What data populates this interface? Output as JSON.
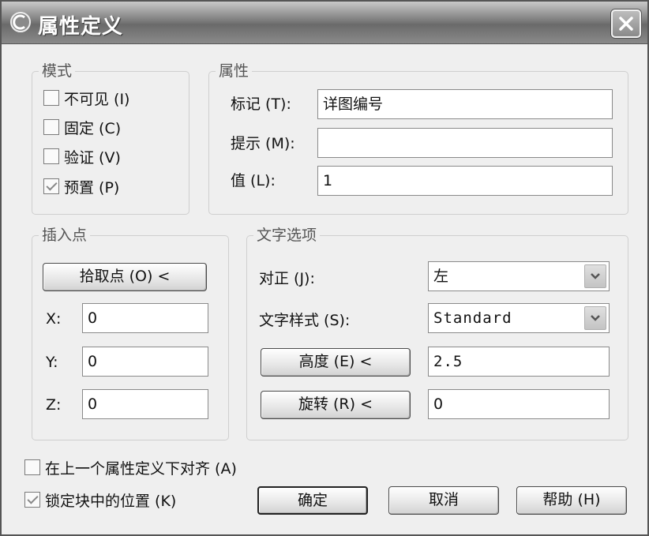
{
  "window": {
    "title": "属性定义",
    "close_label": "✕"
  },
  "mode": {
    "title": "模式",
    "options": [
      {
        "label": "不可见 (I)",
        "checked": false
      },
      {
        "label": "固定 (C)",
        "checked": false
      },
      {
        "label": "验证 (V)",
        "checked": false
      },
      {
        "label": "预置 (P)",
        "checked": true
      }
    ]
  },
  "attribute": {
    "title": "属性",
    "tag_label": "标记 (T):",
    "tag_value": "详图编号",
    "prompt_label": "提示 (M):",
    "prompt_value": "",
    "value_label": "值 (L):",
    "value_value": "1"
  },
  "insertion": {
    "title": "插入点",
    "pick_label": "拾取点 (O) <",
    "x_label": "X:",
    "x_value": "0",
    "y_label": "Y:",
    "y_value": "0",
    "z_label": "Z:",
    "z_value": "0"
  },
  "text_options": {
    "title": "文字选项",
    "justify_label": "对正 (J):",
    "justify_value": "左",
    "style_label": "文字样式 (S):",
    "style_value": "Standard",
    "height_button": "高度 (E) <",
    "height_value": "2.5",
    "rotation_button": "旋转 (R) <",
    "rotation_value": "0"
  },
  "bottom": {
    "align_label": "在上一个属性定义下对齐 (A)",
    "align_checked": false,
    "lock_label": "锁定块中的位置 (K)",
    "lock_checked": true,
    "ok_label": "确定",
    "cancel_label": "取消",
    "help_label": "帮助 (H)"
  }
}
